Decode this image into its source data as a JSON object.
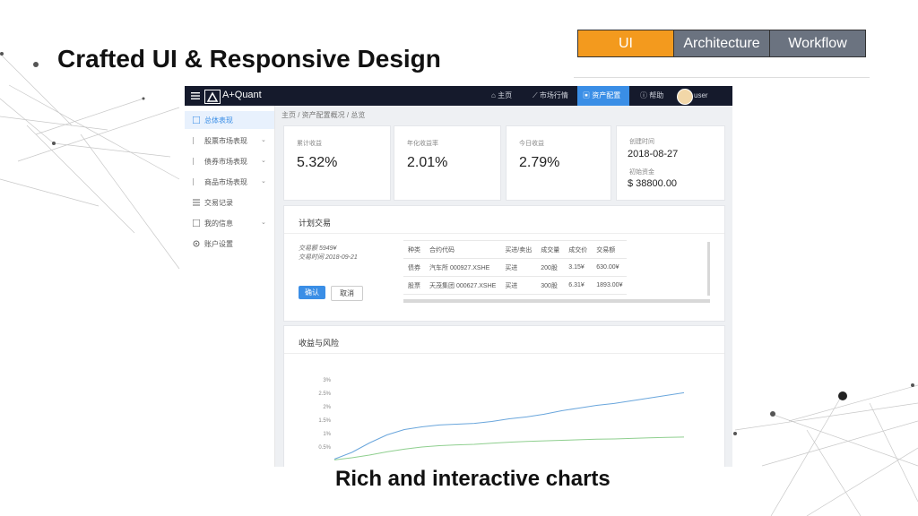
{
  "slide": {
    "title": "Crafted UI & Responsive Design",
    "caption": "Rich and interactive charts",
    "tabs": [
      {
        "label": "UI",
        "active": true
      },
      {
        "label": "Architecture",
        "active": false
      },
      {
        "label": "Workflow",
        "active": false
      }
    ]
  },
  "app": {
    "brand": "A+Quant",
    "nav": [
      "主页",
      "市场行情",
      "资产配置",
      "帮助"
    ],
    "user": "user",
    "sidebar": [
      {
        "label": "总体表现"
      },
      {
        "label": "股票市场表现"
      },
      {
        "label": "债券市场表现"
      },
      {
        "label": "商品市场表现"
      },
      {
        "label": "交易记录"
      },
      {
        "label": "我的信息"
      },
      {
        "label": "账户设置"
      }
    ],
    "breadcrumb": "主页 / 资产配置概况 / 总览",
    "cards": [
      {
        "title": "累计收益",
        "value": "5.32%"
      },
      {
        "title": "年化收益率",
        "value": "2.01%"
      },
      {
        "title": "今日收益",
        "value": "2.79%"
      },
      {
        "title": "创建时间",
        "value": "2018-08-27",
        "title2": "初始资金",
        "value2": "$ 38800.00"
      }
    ],
    "plan": {
      "title": "计划交易",
      "amount": "交易额 5949¥",
      "date": "交易时间 2018-09-21",
      "confirm": "确认",
      "cancel": "取消",
      "columns": [
        "种类",
        "合约代码",
        "买进/卖出",
        "成交量",
        "成交价",
        "交易额"
      ],
      "rows": [
        [
          "债券",
          "汽车所 000927.XSHE",
          "买进",
          "200股",
          "3.15¥",
          "630.00¥"
        ],
        [
          "股票",
          "天茂集团 000627.XSHE",
          "买进",
          "300股",
          "6.31¥",
          "1893.00¥"
        ]
      ]
    },
    "risk": {
      "title": "收益与风险"
    }
  },
  "chart_data": {
    "type": "line",
    "title": "收益与风险",
    "xlabel": "",
    "ylabel": "",
    "ylim": [
      0,
      3
    ],
    "y_ticks": [
      "3%",
      "2.5%",
      "2%",
      "1.5%",
      "1%",
      "0.5%"
    ],
    "x": [
      0,
      1,
      2,
      3,
      4,
      5,
      6,
      7,
      8,
      9,
      10,
      11,
      12,
      13,
      14,
      15,
      16,
      17,
      18,
      19,
      20
    ],
    "series": [
      {
        "color": "#6aa6dc",
        "values": [
          0.05,
          0.3,
          0.65,
          0.95,
          1.15,
          1.25,
          1.32,
          1.35,
          1.38,
          1.45,
          1.55,
          1.62,
          1.72,
          1.85,
          1.95,
          2.05,
          2.12,
          2.22,
          2.32,
          2.42,
          2.52
        ]
      },
      {
        "color": "#8fcf8f",
        "values": [
          0.02,
          0.1,
          0.2,
          0.32,
          0.42,
          0.5,
          0.55,
          0.58,
          0.6,
          0.64,
          0.68,
          0.71,
          0.73,
          0.75,
          0.77,
          0.79,
          0.8,
          0.82,
          0.84,
          0.86,
          0.87
        ]
      }
    ],
    "grid": false,
    "legend": "none"
  }
}
